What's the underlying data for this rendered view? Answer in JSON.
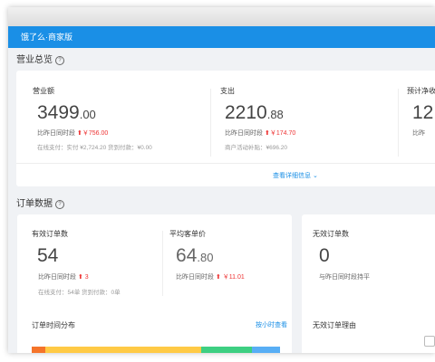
{
  "app": {
    "title": "饿了么·商家版"
  },
  "business": {
    "title": "营业总览",
    "revenue": {
      "label": "营业额",
      "int": "3499",
      "dec": ".00",
      "cmp_label": "比昨日同时段",
      "arrow": "⬆",
      "cmp_value": "￥756.00",
      "detail": "在线支付：实付 ¥2,724.20   货到付款：¥0.00"
    },
    "expense": {
      "label": "支出",
      "int": "2210",
      "dec": ".88",
      "cmp_label": "比昨日同时段",
      "arrow": "⬆",
      "cmp_value": "￥174.70",
      "detail": "商户活动补贴：¥696.20"
    },
    "net": {
      "label": "预计净收",
      "int": "12",
      "cmp_label": "比昨"
    },
    "view_details": "查看详细信息"
  },
  "orders": {
    "title": "订单数据",
    "valid": {
      "label": "有效订单数",
      "value": "54",
      "cmp_label": "比昨日同时段",
      "arrow": "⬆",
      "cmp_value": "3",
      "detail": "在线支付：54单   货到付款：0单"
    },
    "avg": {
      "label": "平均客单价",
      "int": "64",
      "dec": ".80",
      "cmp_label": "比昨日同时段",
      "arrow": "⬆",
      "cmp_value": "￥11.01"
    },
    "invalid": {
      "label": "无效订单数",
      "value": "0",
      "cmp_text": "与昨日同时段持平"
    },
    "distribution": {
      "title": "订单时间分布",
      "link": "按小时查看"
    },
    "invalid_reason": {
      "title": "无效订单理由"
    }
  },
  "colors": {
    "brand": "#1a8fe6",
    "up": "#e33333",
    "bar_orange": "#f5742a",
    "bar_yellow": "#ffca45",
    "bar_green": "#3ecf82",
    "bar_blue": "#58aef5"
  }
}
